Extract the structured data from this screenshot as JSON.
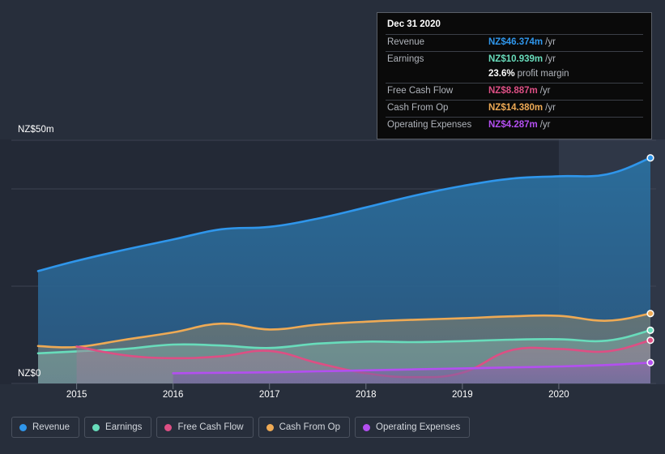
{
  "chart_data": {
    "type": "area",
    "title": "",
    "xlabel": "",
    "ylabel": "",
    "ylim": [
      0,
      50
    ],
    "y_ticks": [
      "NZ$0",
      "NZ$50m"
    ],
    "y_axis_top_label": "NZ$50m",
    "y_axis_bottom_label": "NZ$0",
    "grid": true,
    "legend_position": "bottom-left",
    "currency": "NZ$",
    "units": "m",
    "x": [
      2014.6,
      2015.0,
      2015.5,
      2016.0,
      2016.5,
      2017.0,
      2017.5,
      2018.0,
      2018.5,
      2019.0,
      2019.5,
      2020.0,
      2020.5,
      2020.95
    ],
    "categories": [
      "2015",
      "2016",
      "2017",
      "2018",
      "2019",
      "2020"
    ],
    "series": [
      {
        "name": "Revenue",
        "color": "#2f96eb",
        "values": [
          23.1,
          25.2,
          27.5,
          29.6,
          31.7,
          32.2,
          33.9,
          36.2,
          38.6,
          40.6,
          42.1,
          42.6,
          43.0,
          46.374
        ]
      },
      {
        "name": "Earnings",
        "color": "#68dcbb",
        "values": [
          6.2,
          6.6,
          7.1,
          8.0,
          7.8,
          7.3,
          8.2,
          8.6,
          8.5,
          8.7,
          9.0,
          9.1,
          8.8,
          10.939
        ]
      },
      {
        "name": "Free Cash Flow",
        "color": "#dd4f84",
        "values": [
          null,
          7.6,
          5.8,
          5.2,
          5.6,
          6.7,
          4.2,
          2.1,
          1.3,
          2.2,
          6.8,
          7.1,
          6.6,
          8.887
        ]
      },
      {
        "name": "Cash From Op",
        "color": "#eeaa55",
        "values": [
          7.7,
          7.5,
          9.0,
          10.5,
          12.3,
          11.1,
          12.1,
          12.7,
          13.1,
          13.4,
          13.8,
          13.9,
          12.9,
          14.38
        ]
      },
      {
        "name": "Operating Expenses",
        "color": "#b34ff0",
        "values": [
          null,
          null,
          null,
          2.1,
          2.2,
          2.3,
          2.5,
          2.7,
          2.9,
          3.1,
          3.3,
          3.5,
          3.8,
          4.287
        ]
      }
    ]
  },
  "tooltip": {
    "title": "Dec 31 2020",
    "rows": [
      {
        "key": "Revenue",
        "value": "NZ$46.374m",
        "suffix": "/yr",
        "color": "#2f96eb"
      },
      {
        "key": "Earnings",
        "value": "NZ$10.939m",
        "suffix": "/yr",
        "color": "#68dcbb"
      },
      {
        "key": "",
        "value": "23.6%",
        "suffix": "profit margin",
        "color": "#ffffff"
      },
      {
        "key": "Free Cash Flow",
        "value": "NZ$8.887m",
        "suffix": "/yr",
        "color": "#dd4f84"
      },
      {
        "key": "Cash From Op",
        "value": "NZ$14.380m",
        "suffix": "/yr",
        "color": "#eeaa55"
      },
      {
        "key": "Operating Expenses",
        "value": "NZ$4.287m",
        "suffix": "/yr",
        "color": "#b34ff0"
      }
    ]
  },
  "legend": {
    "items": [
      {
        "label": "Revenue",
        "color": "#2f96eb"
      },
      {
        "label": "Earnings",
        "color": "#68dcbb"
      },
      {
        "label": "Free Cash Flow",
        "color": "#dd4f84"
      },
      {
        "label": "Cash From Op",
        "color": "#eeaa55"
      },
      {
        "label": "Operating Expenses",
        "color": "#b34ff0"
      }
    ]
  },
  "axis": {
    "y_top": "NZ$50m",
    "y_bottom": "NZ$0",
    "x_labels": [
      "2015",
      "2016",
      "2017",
      "2018",
      "2019",
      "2020"
    ]
  },
  "colors": {
    "background": "#272e3b",
    "plot_background": "#232936",
    "gridline": "#454c5a",
    "forecast_band": "#2b3342"
  }
}
